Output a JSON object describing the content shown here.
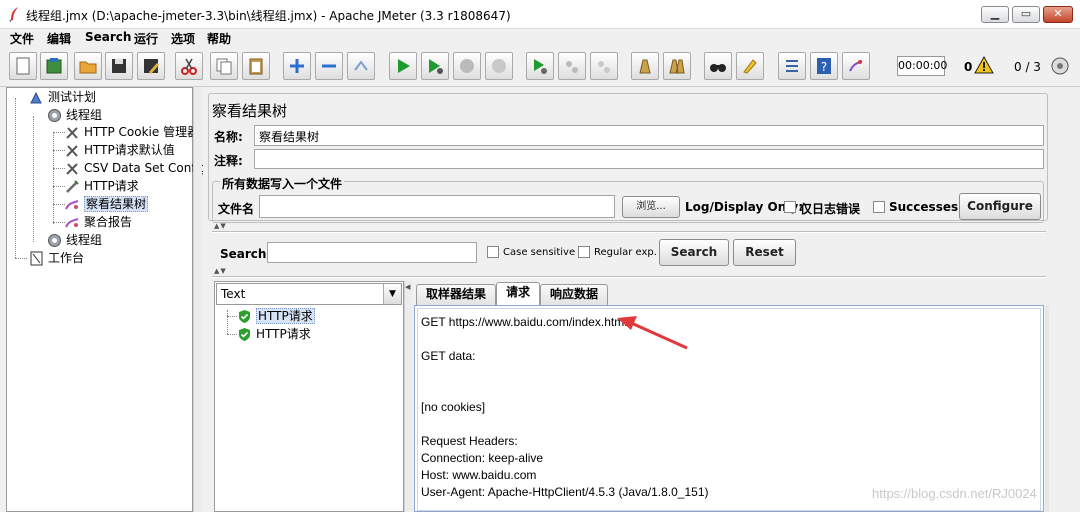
{
  "window": {
    "title": "线程组.jmx (D:\\apache-jmeter-3.3\\bin\\线程组.jmx) - Apache JMeter (3.3 r1808647)"
  },
  "menu": [
    "文件",
    "编辑",
    "Search",
    "运行",
    "选项",
    "帮助"
  ],
  "toolbar": {
    "icons": [
      "new-icon",
      "templates-icon",
      "open-icon",
      "save-icon",
      "save-as-icon",
      "cut-icon",
      "copy-icon",
      "paste-icon",
      "expand-icon",
      "collapse-icon",
      "toggle-icon",
      "start-icon",
      "start-no-pause-icon",
      "stop-icon",
      "shutdown-icon",
      "remote-start-icon",
      "remote-stop-icon",
      "remote-exit-icon",
      "clear-icon",
      "clear-all-icon",
      "search-icon",
      "reset-search-icon",
      "function-helper-icon",
      "help-icon",
      "log-viewer-icon"
    ],
    "timer": "00:00:00",
    "error_count": "0",
    "threads": "0 / 3"
  },
  "tree": [
    {
      "label": "测试计划",
      "icon": "test-plan-icon"
    },
    {
      "label": "线程组",
      "icon": "thread-group-icon"
    },
    {
      "label": "HTTP Cookie 管理器",
      "icon": "config-element-icon"
    },
    {
      "label": "HTTP请求默认值",
      "icon": "config-element-icon"
    },
    {
      "label": "CSV Data Set Config",
      "icon": "config-element-icon"
    },
    {
      "label": "HTTP请求",
      "icon": "sampler-icon"
    },
    {
      "label": "察看结果树",
      "icon": "listener-icon"
    },
    {
      "label": "聚合报告",
      "icon": "listener-icon"
    },
    {
      "label": "线程组",
      "icon": "thread-group-icon"
    },
    {
      "label": "工作台",
      "icon": "workbench-icon"
    }
  ],
  "panel": {
    "title": "察看结果树",
    "name_label": "名称:",
    "name_value": "察看结果树",
    "comment_label": "注释:",
    "comment_value": "",
    "file_group_title": "所有数据写入一个文件",
    "filename_label": "文件名",
    "filename_value": "",
    "browse_button": "浏览...",
    "log_display_label": "Log/Display Only:",
    "errors_only_label": "仅日志错误",
    "successes_label": "Successes",
    "configure_button": "Configure"
  },
  "search": {
    "label": "Search:",
    "value": "",
    "case_sensitive": "Case sensitive",
    "regex": "Regular exp.",
    "search_button": "Search",
    "reset_button": "Reset"
  },
  "results": {
    "renderer": "Text",
    "samples": [
      {
        "label": "HTTP请求",
        "status": "success"
      },
      {
        "label": "HTTP请求",
        "status": "success"
      }
    ],
    "tabs": [
      "取样器结果",
      "请求",
      "响应数据"
    ],
    "active_tab": "请求",
    "request_lines": [
      "GET https://www.baidu.com/index.html",
      "",
      "GET data:",
      "",
      "",
      "",
      "[no cookies]",
      "",
      "Request Headers:",
      "Connection: keep-alive",
      "Host: www.baidu.com",
      "User-Agent: Apache-HttpClient/4.5.3 (Java/1.8.0_151)"
    ]
  },
  "watermark": "https://blog.csdn.net/RJ0024",
  "colors": {
    "accent_arrow": "#e0393b",
    "success_green": "#2e9e2e",
    "selection": "#d7e4f7"
  }
}
